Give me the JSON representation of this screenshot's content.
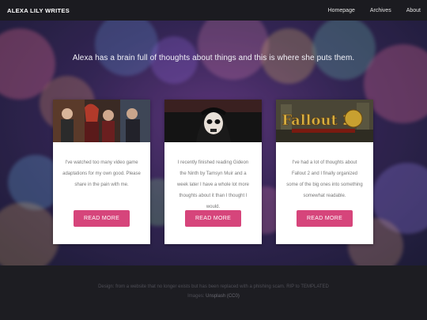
{
  "site": {
    "brand": "ALEXA LILY WRITES",
    "nav": [
      {
        "label": "Homepage"
      },
      {
        "label": "Archives"
      },
      {
        "label": "About"
      }
    ]
  },
  "hero": {
    "tagline": "Alexa has a brain full of thoughts about things and this is where she puts them."
  },
  "cards": [
    {
      "text": "I've watched too many video game adaptations for my own good. Please share in the pain with me.",
      "button": "READ MORE",
      "image": "movie-characters-collage"
    },
    {
      "text": "I recently finished reading Gideon the Ninth by Tamsyn Muir and a week later I have a whole lot more thoughts about it than I thought I would.",
      "button": "READ MORE",
      "image": "skull-painted-face"
    },
    {
      "text": "I've had a lot of thoughts about Fallout 2 and I finally organized some of the big ones into something somewhat readable.",
      "button": "READ MORE",
      "image": "fallout-2-logo",
      "image_text": "Fallout 2"
    }
  ],
  "footer": {
    "line1": "Design: from a website that no longer exists but has been replaced with a phishing scam. RIP to TEMPLATED",
    "line2_prefix": "Images: ",
    "line2_link": "Unsplash (CC0)"
  },
  "colors": {
    "accent": "#d6457b",
    "topbar": "#1b1b20",
    "footer": "#1d1d22"
  }
}
